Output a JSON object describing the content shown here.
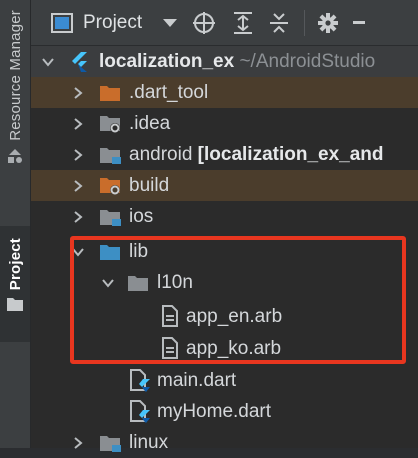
{
  "sidebar": {
    "tabs": [
      {
        "label": "Resource Manager",
        "icon": "resource-manager-icon",
        "active": false
      },
      {
        "label": "Project",
        "icon": "folder-icon",
        "active": true
      }
    ]
  },
  "header": {
    "title": "Project",
    "icons": [
      "project-view-icon",
      "chevron-down-icon",
      "locate-icon",
      "expand-all-icon",
      "collapse-all-icon",
      "gear-icon"
    ]
  },
  "tree": {
    "root": {
      "label": "localization_ex",
      "path": "~/AndroidStudio"
    },
    "items": [
      {
        "label": ".dart_tool",
        "icon": "folder-icon"
      },
      {
        "label": ".idea",
        "icon": "config-folder-icon"
      },
      {
        "label": "android",
        "suffix": "[localization_ex_and",
        "icon": "module-folder-icon"
      },
      {
        "label": "build",
        "icon": "excluded-folder-icon"
      },
      {
        "label": "ios",
        "icon": "folder-icon"
      },
      {
        "label": "lib",
        "icon": "source-folder-icon"
      },
      {
        "label": "l10n",
        "icon": "folder-icon"
      },
      {
        "label": "app_en.arb",
        "icon": "file-icon"
      },
      {
        "label": "app_ko.arb",
        "icon": "file-icon"
      },
      {
        "label": "main.dart",
        "icon": "dart-file-icon"
      },
      {
        "label": "myHome.dart",
        "icon": "dart-file-icon"
      },
      {
        "label": "linux",
        "icon": "folder-icon"
      }
    ]
  },
  "colors": {
    "highlight": "#e8361f",
    "folder": "#8a8e92",
    "excluded_folder": "#c96d2b",
    "source_folder": "#3d8fc4"
  }
}
